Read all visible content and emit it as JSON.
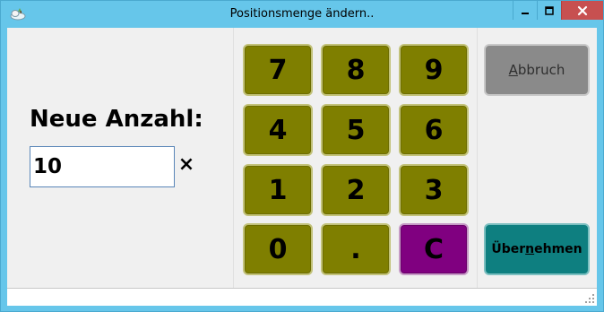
{
  "window": {
    "title": "Positionsmenge ändern..",
    "icon": "app-cloud-icon",
    "controls": {
      "minimize": "minimize-icon",
      "maximize": "maximize-icon",
      "close": "close-icon"
    }
  },
  "quantity": {
    "label": "Neue Anzahl:",
    "value": "10",
    "clear_symbol": "×"
  },
  "keypad": {
    "keys": [
      "7",
      "8",
      "9",
      "4",
      "5",
      "6",
      "1",
      "2",
      "3",
      "0",
      ".",
      "C"
    ]
  },
  "actions": {
    "cancel_label": "Abbruch",
    "cancel_mnemonic": "A",
    "apply_label": "Übernehmen",
    "apply_mnemonic": "n"
  },
  "colors": {
    "titlebar": "#66c6ea",
    "key_face": "#7f7f00",
    "clear_key_face": "#800080",
    "cancel_face": "#8a8a8a",
    "apply_face": "#0e7f80",
    "close_button": "#c75050"
  }
}
